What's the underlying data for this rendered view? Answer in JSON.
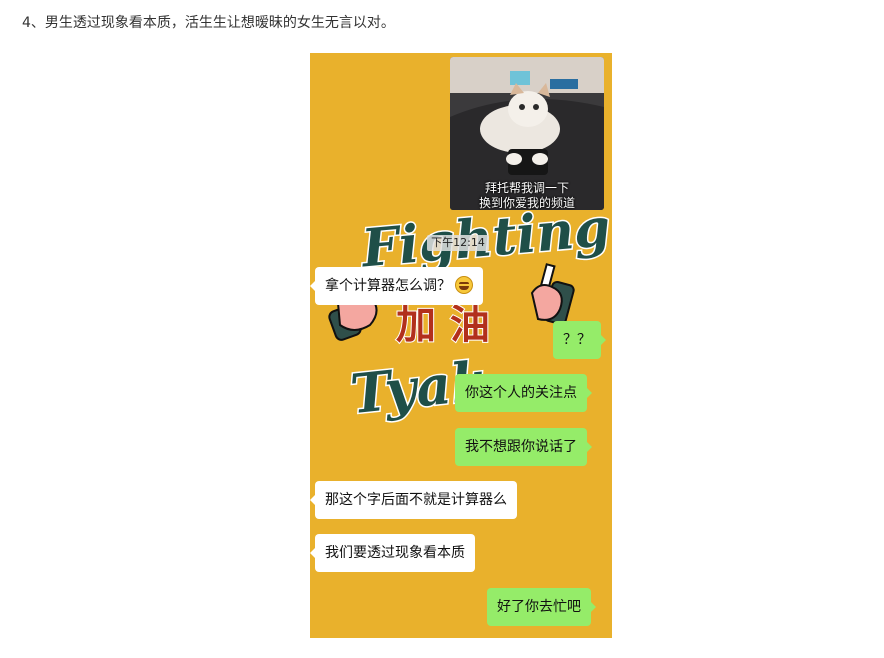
{
  "article": {
    "caption": "4、男生透过现象看本质，活生生让想暧昧的女生无言以对。"
  },
  "image": {
    "photo_caption_line1": "拜托帮我调一下",
    "photo_caption_line2": "换到你爱我的频道",
    "timestamp": "下午12:14",
    "wallpaper": {
      "word_top": "Fighting",
      "word_middle": "加 油",
      "word_bottom": "Tyak"
    },
    "messages": [
      {
        "side": "in",
        "text": "拿个计算器怎么调？",
        "emoji": "laughing-emoji"
      },
      {
        "side": "out",
        "text": "？？"
      },
      {
        "side": "out",
        "text": "你这个人的关注点"
      },
      {
        "side": "out",
        "text": "我不想跟你说话了"
      },
      {
        "side": "in",
        "text": "那这个字后面不就是计算器么"
      },
      {
        "side": "in",
        "text": "我们要透过现象看本质"
      },
      {
        "side": "out",
        "text": "好了你去忙吧"
      }
    ]
  },
  "colors": {
    "wallpaper_yellow": "#e9b12c",
    "outgoing_bubble": "#95ec69",
    "incoming_bubble": "#ffffff",
    "lettering_green": "#1f4f48",
    "lettering_red": "#b2301c"
  }
}
